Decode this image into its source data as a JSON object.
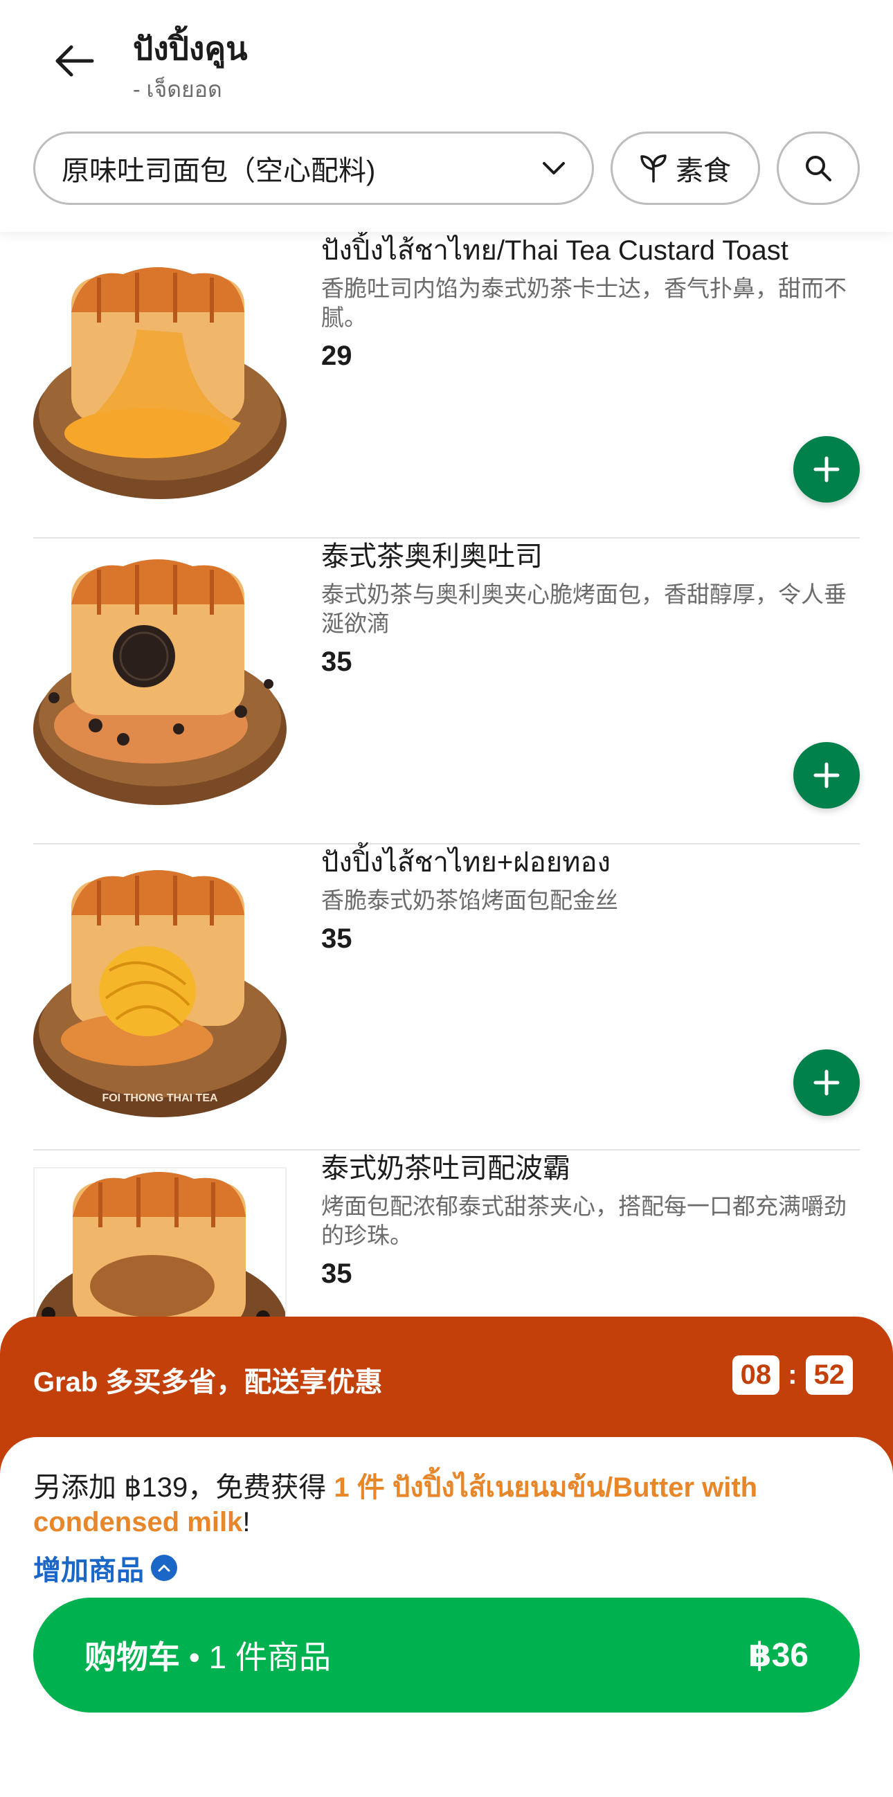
{
  "header": {
    "store_name": "ปังปิ้งคูน",
    "store_branch": "- เจ็ดยอด",
    "category_selected": "原味吐司面包（空心配料)",
    "veg_label": "素食"
  },
  "items": [
    {
      "name": "ปังปิ้งไส้ชาไทย/Thai Tea Custard Toast",
      "desc": "香脆吐司内馅为泰式奶茶卡士达，香气扑鼻，甜而不腻。",
      "price": "29",
      "photo_icon": "thai-tea-custard-toast"
    },
    {
      "name": "泰式茶奥利奥吐司",
      "desc": "泰式奶茶与奥利奥夹心脆烤面包，香甜醇厚，令人垂涎欲滴",
      "price": "35",
      "photo_icon": "oreo-toast"
    },
    {
      "name": "ปังปิ้งไส้ชาไทย+ฝอยทอง",
      "desc": "香脆泰式奶茶馅烤面包配金丝",
      "price": "35",
      "photo_icon": "foi-thong-toast",
      "plate_text": "FOI THONG THAI TEA"
    },
    {
      "name": "泰式奶茶吐司配波霸",
      "desc": "烤面包配浓郁泰式甜茶夹心，搭配每一口都充满嚼劲的珍珠。",
      "price": "35",
      "photo_icon": "boba-toast"
    }
  ],
  "promo": {
    "title": "Grab 多买多省，配送享优惠",
    "timer_min": "08",
    "timer_sep": ":",
    "timer_sec": "52"
  },
  "cart": {
    "offer_prefix": "另添加 ฿139，免费获得 ",
    "offer_highlight": "1 件 ปังปิ้งไส้เนยนมข้น/Butter with condensed milk",
    "offer_suffix": "!",
    "add_more": "增加商品",
    "button_label": "购物车",
    "button_sep": " • ",
    "button_count": "1 件商品",
    "button_total": "฿36"
  },
  "colors": {
    "grab_green": "#00b14f",
    "add_green": "#00804a",
    "promo_orange": "#c3400a",
    "highlight": "#e8862a",
    "link_blue": "#1a67c7"
  }
}
